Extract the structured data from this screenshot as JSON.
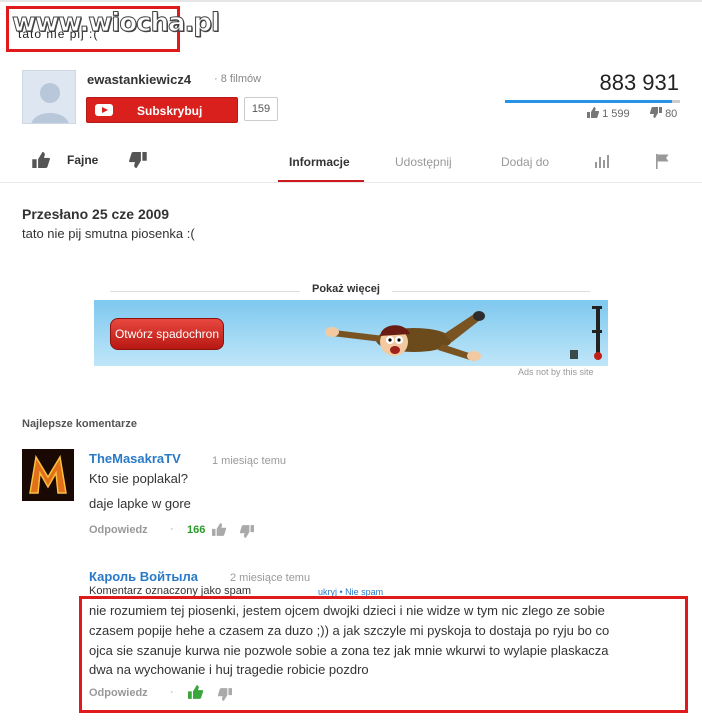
{
  "watermark": {
    "text": "www.wiocha.pl",
    "covered_text": "tato nie pij :("
  },
  "channel": {
    "name": "ewastankiewicz4",
    "videos": "· 8 filmów",
    "subscribe_label": "Subskrybuj",
    "subscriber_count": "159"
  },
  "stats": {
    "views": "883 931",
    "likes": "1 599",
    "dislikes": "80",
    "like_ratio": 0.952,
    "colors": {
      "like": "#2793e6",
      "dislike": "#cccccc"
    }
  },
  "actions": {
    "like_label": "Fajne"
  },
  "tabs": [
    {
      "label": "Informacje",
      "active": true
    },
    {
      "label": "Udostępnij",
      "active": false
    },
    {
      "label": "Dodaj do",
      "active": false
    }
  ],
  "description": {
    "uploaded": "Przesłano 25 cze 2009",
    "text": "tato nie pij smutna piosenka :(",
    "show_more": "Pokaż więcej"
  },
  "ad": {
    "button_label": "Otwórz spadochron",
    "note": "Ads not by this site"
  },
  "comments_section": {
    "heading": "Najlepsze komentarze"
  },
  "comments": [
    {
      "author": "TheMasakraTV",
      "time": "1 miesiąc temu",
      "lines": [
        "Kto sie poplakal?",
        "daje lapke w gore"
      ],
      "reply": "Odpowiedz",
      "dot": "·",
      "likes": "166"
    },
    {
      "author": "Кароль Войтыла",
      "time": "2 miesiące temu",
      "spam_note": "Komentarz oznaczony jako spam",
      "spam_links": "ukryj • Nie spam",
      "lines": [
        "nie rozumiem tej piosenki, jestem ojcem dwojki dzieci i nie widze w tym nic zlego ze sobie",
        "czasem popije hehe a czasem za duzo ;)) a jak szczyle mi pyskoja to dostaja po ryju bo co",
        "ojca sie szanuje kurwa nie pozwole sobie a zona tez jak mnie wkurwi to wylapie plaskacza",
        "dwa na wychowanie i huj tragedie robicie pozdro"
      ],
      "reply": "Odpowiedz",
      "dot": "·"
    }
  ]
}
